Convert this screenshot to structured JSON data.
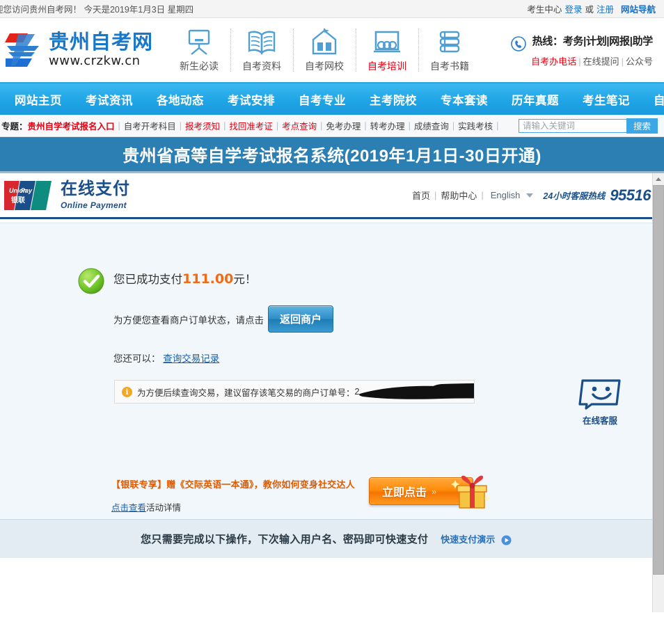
{
  "topbar": {
    "welcome": "迎您访问贵州自考网！  今天是2019年1月3日 星期四",
    "member_center": "考生中心",
    "login": "登录",
    "or": "或",
    "register": "注册",
    "site_nav": "网站导航"
  },
  "header": {
    "logo_cn": "贵州自考网",
    "logo_url": "www.crzkw.cn",
    "quicknav": [
      {
        "label": "新生必读",
        "icon": "easel-icon",
        "active": false
      },
      {
        "label": "自考资料",
        "icon": "open-book-icon",
        "active": false
      },
      {
        "label": "自考网校",
        "icon": "school-building-icon",
        "active": false
      },
      {
        "label": "自考培训",
        "icon": "classroom-icon",
        "active": true
      },
      {
        "label": "自考书籍",
        "icon": "stacked-books-icon",
        "active": false
      }
    ],
    "hotline_label": "热线：",
    "hotline_items": "考务|计划|网报|助学",
    "office_phone": "自考办电话",
    "online_ask": "在线提问",
    "public_account": "公众号"
  },
  "mainnav": [
    "网站主页",
    "考试资讯",
    "各地动态",
    "考试安排",
    "自考专业",
    "主考院校",
    "专本套读",
    "历年真题",
    "考生笔记",
    "自考答疑"
  ],
  "topics": {
    "label": "专题：",
    "featured": "贵州自学考试报名入口",
    "items": [
      {
        "text": "自考开考科目",
        "red": false
      },
      {
        "text": "报考须知",
        "red": true
      },
      {
        "text": "找回准考证",
        "red": true
      },
      {
        "text": "考点查询",
        "red": true
      },
      {
        "text": "免考办理",
        "red": false
      },
      {
        "text": "转考办理",
        "red": false
      },
      {
        "text": "成绩查询",
        "red": false
      },
      {
        "text": "实践考核",
        "red": false
      }
    ],
    "search_placeholder": "请输入关键词",
    "search_button": "搜索"
  },
  "banner": {
    "title": "贵州省高等自学考试报名系统(2019年1月1日-30日开通)"
  },
  "payment": {
    "brand_cn": "在线支付",
    "brand_en": "Online Payment",
    "brand_badge": "UnionPay",
    "brand_badge_cn": "银联",
    "nav": {
      "home": "首页",
      "help": "帮助中心",
      "language": "English",
      "hotline_label": "24小时客服热线",
      "hotline_number": "95516"
    },
    "success_prefix": "您已成功支付",
    "success_amount": "111.00",
    "success_suffix": "元！",
    "merchant_hint": "为方便您查看商户订单状态，请点击",
    "back_button": "返回商户",
    "also_can_label": "您还可以：",
    "query_record_link": "查询交易记录",
    "order_notice_prefix": "为方便后续查询交易，建议留存该笔交易的商户订单号：",
    "order_number_visible": "2",
    "order_number_redacted": true,
    "customer_service": "在线客服",
    "promos": [
      {
        "title": "【银联专享】赠《交际英语一本通》，教你如何变身社交达人",
        "link": "点击查看",
        "link_suffix": "活动详情",
        "button_label": "立即点击",
        "button_arrow": "»"
      },
      {
        "title": "",
        "link": "点击查看",
        "link_suffix": "活动详情",
        "button_label": "",
        "button_arrow": "»"
      }
    ],
    "quickpay_text": "您只需要完成以下操作，下次输入用户名、密码即可快速支付",
    "quickpay_demo": "快速支付演示"
  },
  "colors": {
    "nav_blue": "#1fa5e6",
    "banner_blue": "#2c7fb2",
    "unionpay_navy": "#1b4f8a",
    "accent_red": "#e60012",
    "amount_orange": "#f26a12",
    "promo_orange": "#ff8c0a"
  }
}
